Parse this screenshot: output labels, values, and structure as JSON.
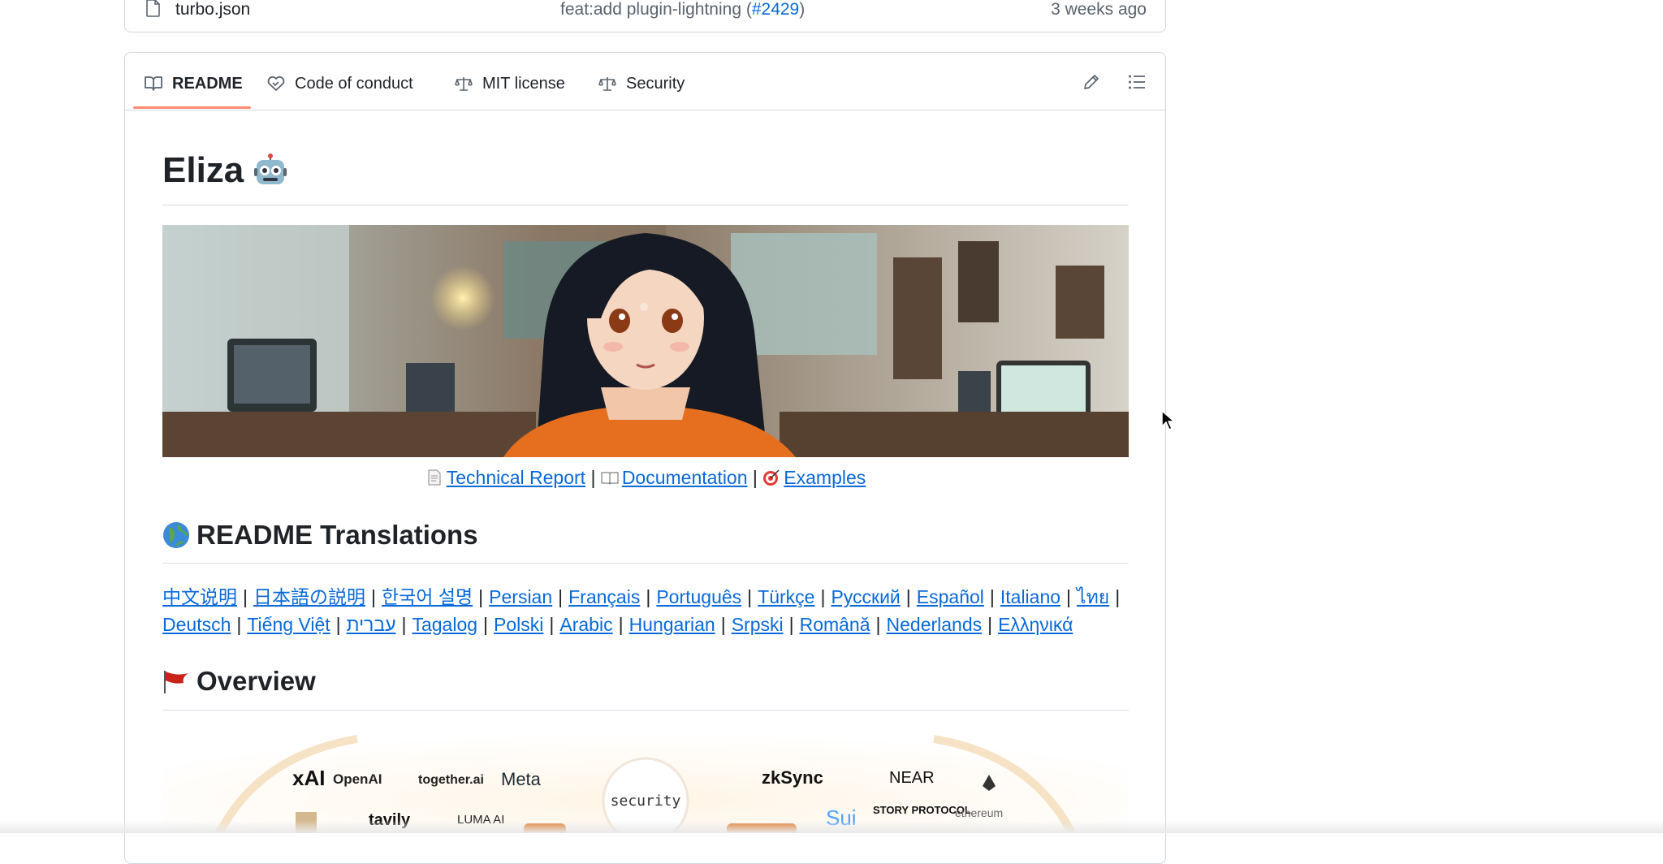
{
  "file_row": {
    "name": "turbo.json",
    "commit_message": "feat:add plugin-lightning (",
    "commit_pr": "#2429",
    "commit_close": ")",
    "age": "3 weeks ago"
  },
  "tabs": [
    {
      "label": "README",
      "icon": "book-icon",
      "active": true
    },
    {
      "label": "Code of conduct",
      "icon": "heart-handshake-icon",
      "active": false
    },
    {
      "label": "MIT license",
      "icon": "law-scale-icon",
      "active": false
    },
    {
      "label": "Security",
      "icon": "law-scale-icon",
      "active": false
    }
  ],
  "toolbar": {
    "edit_icon": "pencil-icon",
    "outline_icon": "list-icon"
  },
  "readme": {
    "title": "Eliza",
    "title_emoji": "robot-emoji",
    "links": [
      {
        "label": "Technical Report",
        "icon": "page-emoji"
      },
      {
        "label": "Documentation",
        "icon": "book-emoji"
      },
      {
        "label": "Examples",
        "icon": "target-emoji"
      }
    ],
    "separator": "|",
    "translations_heading": "README Translations",
    "translations": [
      "中文说明",
      "日本語の説明",
      "한국어 설명",
      "Persian",
      "Français",
      "Português",
      "Türkçe",
      "Русский",
      "Español",
      "Italiano",
      "ไทย",
      "Deutsch",
      "Tiếng Việt",
      "עברית",
      "Tagalog",
      "Polski",
      "Arabic",
      "Hungarian",
      "Srpski",
      "Română",
      "Nederlands",
      "Ελληνικά"
    ],
    "overview_heading": "Overview",
    "logos": {
      "left": [
        "xAI",
        "OpenAI",
        "together.ai",
        "Meta",
        "tavily",
        "LUMA AI"
      ],
      "center": "security",
      "right": [
        "zkSync",
        "NEAR",
        "Sui",
        "STORY PROTOCOL",
        "ethereum"
      ]
    }
  },
  "colors": {
    "link": "#0969da",
    "tab_underline": "#fd8c73",
    "border": "#d0d7de"
  }
}
